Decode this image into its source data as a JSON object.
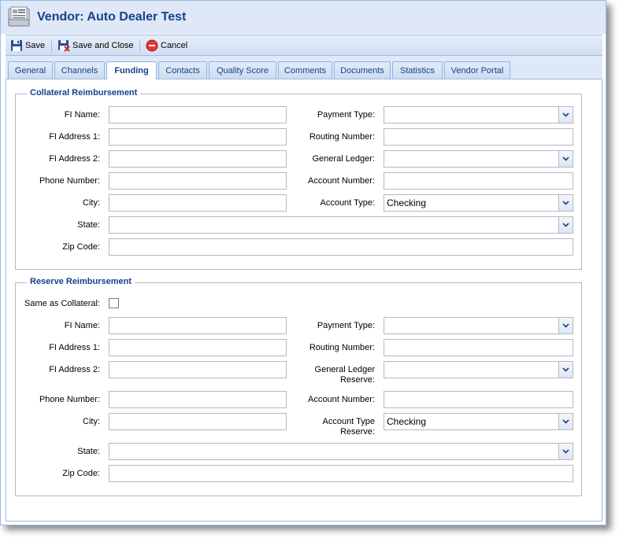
{
  "window": {
    "title": "Vendor: Auto Dealer Test",
    "icon": "vendor-document-icon"
  },
  "toolbar": {
    "save_label": "Save",
    "save_close_label": "Save and Close",
    "cancel_label": "Cancel"
  },
  "tabs": [
    {
      "label": "General"
    },
    {
      "label": "Channels"
    },
    {
      "label": "Funding",
      "active": true
    },
    {
      "label": "Contacts"
    },
    {
      "label": "Quality Score"
    },
    {
      "label": "Comments"
    },
    {
      "label": "Documents"
    },
    {
      "label": "Statistics"
    },
    {
      "label": "Vendor Portal"
    }
  ],
  "collateral": {
    "legend": "Collateral Reimbursement",
    "fi_name_label": "FI Name:",
    "fi_name_value": "",
    "fi_address1_label": "FI Address 1:",
    "fi_address1_value": "",
    "fi_address2_label": "FI Address 2:",
    "fi_address2_value": "",
    "phone_label": "Phone Number:",
    "phone_value": "",
    "city_label": "City:",
    "city_value": "",
    "state_label": "State:",
    "state_value": "",
    "zip_label": "Zip Code:",
    "zip_value": "",
    "payment_type_label": "Payment Type:",
    "payment_type_value": "",
    "routing_label": "Routing Number:",
    "routing_value": "",
    "general_ledger_label": "General Ledger:",
    "general_ledger_value": "",
    "account_number_label": "Account Number:",
    "account_number_value": "",
    "account_type_label": "Account Type:",
    "account_type_value": "Checking"
  },
  "reserve": {
    "legend": "Reserve Reimbursement",
    "same_as_label": "Same as Collateral:",
    "same_as_checked": false,
    "fi_name_label": "FI Name:",
    "fi_name_value": "",
    "fi_address1_label": "FI Address 1:",
    "fi_address1_value": "",
    "fi_address2_label": "FI Address 2:",
    "fi_address2_value": "",
    "phone_label": "Phone Number:",
    "phone_value": "",
    "city_label": "City:",
    "city_value": "",
    "state_label": "State:",
    "state_value": "",
    "zip_label": "Zip Code:",
    "zip_value": "",
    "payment_type_label": "Payment Type:",
    "payment_type_value": "",
    "routing_label": "Routing Number:",
    "routing_value": "",
    "general_ledger_label_1": "General Ledger",
    "general_ledger_label_2": "Reserve:",
    "general_ledger_value": "",
    "account_number_label": "Account Number:",
    "account_number_value": "",
    "account_type_label_1": "Account Type",
    "account_type_label_2": "Reserve:",
    "account_type_value": "Checking"
  },
  "colors": {
    "accent": "#15428b",
    "border": "#99bbe8",
    "tab_bg": "#dfe8f6"
  }
}
